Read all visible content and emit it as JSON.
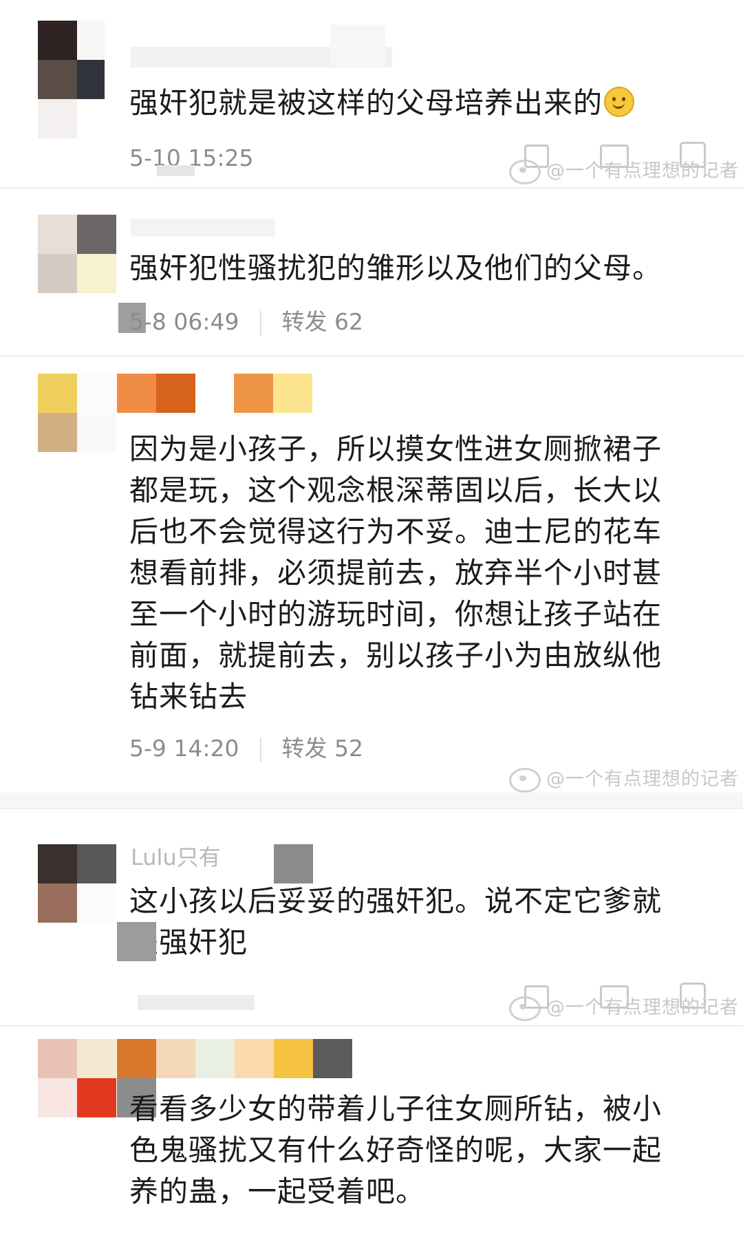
{
  "comments": [
    {
      "text": "强奸犯就是被这样的父母培养出来的",
      "emoji": "smiley-emoji",
      "time": "5-10 15:25"
    },
    {
      "text": "强奸犯性骚扰犯的雏形以及他们的父母。",
      "time": "5-8 06:49",
      "repost_label": "转发",
      "repost_count": "62"
    },
    {
      "lines": [
        "因为是小孩子，所以摸女性进女厕掀裙子",
        "都是玩，这个观念根深蒂固以后，长大以",
        "后也不会觉得这行为不妥。迪士尼的花车",
        "想看前排，必须提前去，放弃半个小时甚",
        "至一个小时的游玩时间，你想让孩子站在",
        "前面，就提前去，别以孩子小为由放纵他",
        "钻来钻去"
      ],
      "time": "5-9 14:20",
      "repost_label": "转发",
      "repost_count": "52"
    },
    {
      "lines": [
        "这小孩以后妥妥的强奸犯。说不定它爹就",
        "是强奸犯"
      ],
      "author_partial": "Lulu只有"
    },
    {
      "lines": [
        "看看多少女的带着儿子往女厕所钻，被小",
        "色鬼骚扰又有什么好奇怪的呢，大家一起",
        "养的蛊，一起受着吧。"
      ]
    }
  ],
  "watermark": "@一个有点理想的记者",
  "icons": [
    "share-icon",
    "comment-icon",
    "like-icon",
    "weibo-logo-icon"
  ],
  "colors": {
    "text": "#1b1b1b",
    "meta": "#8c8c8c",
    "watermark": "#c8c8c8"
  }
}
